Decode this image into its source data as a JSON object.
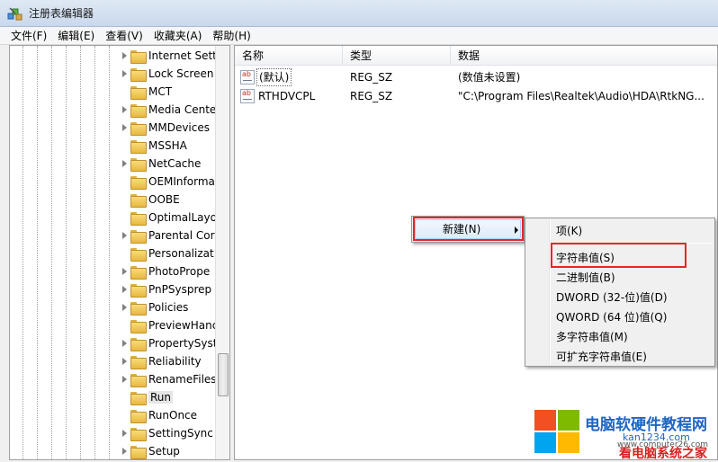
{
  "window": {
    "title": "注册表编辑器"
  },
  "menubar": [
    "文件(F)",
    "编辑(E)",
    "查看(V)",
    "收藏夹(A)",
    "帮助(H)"
  ],
  "tree": {
    "items": [
      {
        "label": "Internet Sett",
        "expandable": true
      },
      {
        "label": "Lock Screen",
        "expandable": true
      },
      {
        "label": "MCT",
        "expandable": false
      },
      {
        "label": "Media Cente",
        "expandable": true
      },
      {
        "label": "MMDevices",
        "expandable": true
      },
      {
        "label": "MSSHA",
        "expandable": false
      },
      {
        "label": "NetCache",
        "expandable": true
      },
      {
        "label": "OEMInforma",
        "expandable": false
      },
      {
        "label": "OOBE",
        "expandable": false
      },
      {
        "label": "OptimalLayo",
        "expandable": false
      },
      {
        "label": "Parental Cor",
        "expandable": true
      },
      {
        "label": "Personalizat",
        "expandable": false
      },
      {
        "label": "PhotoPrope",
        "expandable": true
      },
      {
        "label": "PnPSysprep",
        "expandable": true
      },
      {
        "label": "Policies",
        "expandable": true
      },
      {
        "label": "PreviewHanc",
        "expandable": false
      },
      {
        "label": "PropertySyst",
        "expandable": true
      },
      {
        "label": "Reliability",
        "expandable": true
      },
      {
        "label": "RenameFiles",
        "expandable": true
      },
      {
        "label": "Run",
        "expandable": false,
        "selected": true
      },
      {
        "label": "RunOnce",
        "expandable": false
      },
      {
        "label": "SettingSync",
        "expandable": true
      },
      {
        "label": "Setup",
        "expandable": true
      }
    ]
  },
  "list": {
    "columns": [
      "名称",
      "类型",
      "数据"
    ],
    "rows": [
      {
        "name": "(默认)",
        "type": "REG_SZ",
        "data": "(数值未设置)"
      },
      {
        "name": "RTHDVCPL",
        "type": "REG_SZ",
        "data": "\"C:\\Program Files\\Realtek\\Audio\\HDA\\RtkNG..."
      }
    ]
  },
  "context_menu": {
    "new_label": "新建(N)"
  },
  "submenu": {
    "items": [
      "项(K)",
      "字符串值(S)",
      "二进制值(B)",
      "DWORD (32-位)值(D)",
      "QWORD (64 位)值(Q)",
      "多字符串值(M)",
      "可扩充字符串值(E)"
    ]
  },
  "watermark": {
    "title": "电脑软硬件教程网",
    "url": "kan1234.com",
    "domain": "www.computer26.com",
    "slogan": "看电脑系统之家",
    "colors": [
      "#f25022",
      "#7fba00",
      "#00a4ef",
      "#ffb900"
    ]
  }
}
